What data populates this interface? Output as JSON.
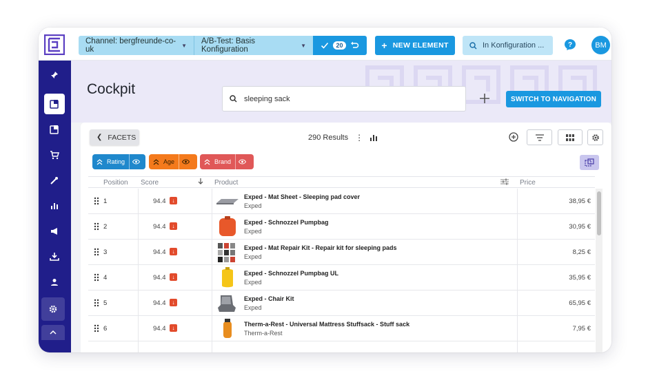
{
  "topbar": {
    "channel_label": "Channel: bergfreunde-co-uk",
    "ab_label": "A/B-Test: Basis Konfiguration",
    "confirm_count": "20",
    "new_element_label": "NEW ELEMENT",
    "config_search_label": "In Konfiguration ...",
    "avatar_initials": "BM"
  },
  "page": {
    "title": "Cockpit",
    "search_value": "sleeping sack",
    "switch_label": "SWITCH TO NAVIGATION"
  },
  "panel": {
    "facets_label": "FACETS",
    "results_label": "290 Results"
  },
  "chips": [
    {
      "label": "Rating",
      "color": "#1f88cc"
    },
    {
      "label": "Age",
      "color": "#f47a1c"
    },
    {
      "label": "Brand",
      "color": "#e05858"
    }
  ],
  "table": {
    "headers": {
      "position": "Position",
      "score": "Score",
      "product": "Product",
      "price": "Price"
    },
    "rows": [
      {
        "position": "1",
        "score": "94.4",
        "name": "Exped - Mat Sheet - Sleeping pad cover",
        "brand": "Exped",
        "price": "38,95 €",
        "image": "grey-pad"
      },
      {
        "position": "2",
        "score": "94.4",
        "name": "Exped - Schnozzel Pumpbag",
        "brand": "Exped",
        "price": "30,95 €",
        "image": "orange-bag"
      },
      {
        "position": "3",
        "score": "94.4",
        "name": "Exped - Mat Repair Kit - Repair kit for sleeping pads",
        "brand": "Exped",
        "price": "8,25 €",
        "image": "repair-kit"
      },
      {
        "position": "4",
        "score": "94.4",
        "name": "Exped - Schnozzel Pumpbag UL",
        "brand": "Exped",
        "price": "35,95 €",
        "image": "yellow-bag"
      },
      {
        "position": "5",
        "score": "94.4",
        "name": "Exped - Chair Kit",
        "brand": "Exped",
        "price": "65,95 €",
        "image": "chair-kit"
      },
      {
        "position": "6",
        "score": "94.4",
        "name": "Therm-a-Rest - Universal Mattress Stuffsack - Stuff sack",
        "brand": "Therm-a-Rest",
        "price": "7,95 €",
        "image": "orange-stuffsack"
      }
    ]
  },
  "colors": {
    "accent": "#1a98e0",
    "sidebar": "#201e8a",
    "score_down": "#e24b2c"
  }
}
